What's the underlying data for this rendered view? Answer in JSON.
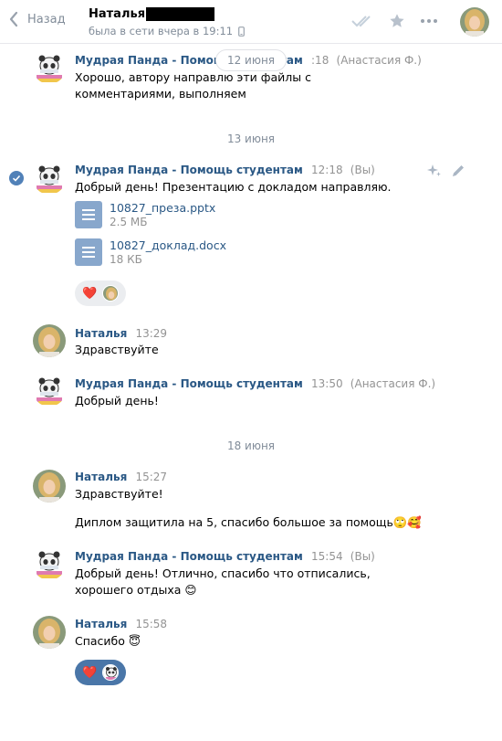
{
  "header": {
    "back_label": "Назад",
    "name": "Наталья",
    "status": "была в сети вчера в 19:11"
  },
  "floating_date": "12 июня",
  "messages": [
    {
      "name": "Мудрая Панда - Помощь студентам",
      "time": "13:18",
      "sub": "(Анастасия Ф.)",
      "time_visible": ":18",
      "text": "Хорошо, автору направлю эти файлы с комментариями, выполняем"
    },
    {
      "name": "Мудрая Панда - Помощь студентам",
      "time": "12:18",
      "sub": "(Вы)",
      "text": "Добрый день! Презентацию с докладом направляю."
    },
    {
      "name": "Наталья",
      "time": "13:29",
      "text": "Здравствуйте"
    },
    {
      "name": "Мудрая Панда - Помощь студентам",
      "time": "13:50",
      "sub": "(Анастасия Ф.)",
      "text": "Добрый день!"
    },
    {
      "name": "Наталья",
      "time": "15:27",
      "text": "Здравствуйте!",
      "text2": "Диплом защитила на 5, спасибо большое за помощь🙄🥰"
    },
    {
      "name": "Мудрая Панда - Помощь студентам",
      "time": "15:54",
      "sub": "(Вы)",
      "text": "Добрый день! Отлично, спасибо что отписались, хорошего отдыха 😊"
    },
    {
      "name": "Наталья",
      "time": "15:58",
      "text": "Спасибо 😇"
    }
  ],
  "dates": [
    "13 июня",
    "18 июня"
  ],
  "files": [
    {
      "name": "10827_преза.pptx",
      "size": "2.5 МБ"
    },
    {
      "name": "10827_доклад.docx",
      "size": "18 КБ"
    }
  ],
  "reactions": [
    "❤️",
    "❤️"
  ],
  "colors": {
    "link": "#2a5885",
    "muted": "#939393",
    "accent": "#4a76a8",
    "file_icon": "#88a7cc"
  },
  "icons": [
    "back-chevron-icon",
    "phone-icon",
    "double-check-icon",
    "star-icon",
    "more-icon",
    "selected-check-icon",
    "sparkle-icon",
    "pencil-icon",
    "document-icon"
  ]
}
